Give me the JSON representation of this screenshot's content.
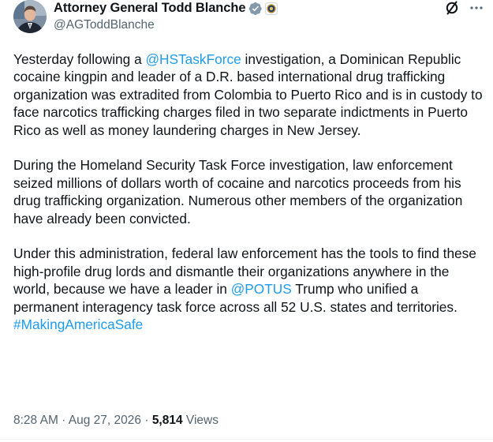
{
  "author": {
    "display_name": "Attorney General Todd Blanche",
    "handle": "@AGToddBlanche",
    "verified_icon": "verified-badge-icon",
    "affiliation_icon": "government-seal-icon"
  },
  "actions": {
    "grok_icon": "grok-icon",
    "more_icon": "more-options-icon"
  },
  "tweet": {
    "p1": {
      "t1": "Yesterday following a ",
      "mention1": "@HSTaskForce",
      "t2": " investigation, a Dominican Republic cocaine kingpin and leader of a D.R. based international drug trafficking organization was extradited from Colombia to Puerto Rico and is in custody to face narcotics trafficking charges filed in two separate indictments in Puerto Rico as well as money laundering charges in New Jersey."
    },
    "p2": {
      "text": "During the Homeland Security Task Force investigation, law enforcement seized millions of dollars worth of cocaine and narcotics proceeds from his drug trafficking organization. Numerous other members of the organization have already been convicted."
    },
    "p3": {
      "t1": "Under this administration, federal law enforcement has the tools to find these high-profile drug lords and dismantle their organizations anywhere in the world, because we have a leader in ",
      "mention1": "@POTUS",
      "t2": " Trump who unified a permanent interagency task force across all 52 U.S. states and territories. ",
      "hashtag1": "#MakingAmericaSafe"
    }
  },
  "meta": {
    "time": "8:28 AM",
    "separator": " · ",
    "date": "Aug 27, 2026",
    "separator2": " · ",
    "views_count": "5,814",
    "views_label": " Views"
  },
  "colors": {
    "link": "#1d9bf0",
    "secondary_text": "#536471",
    "primary_text": "#0f1419",
    "verified": "#829aab"
  }
}
